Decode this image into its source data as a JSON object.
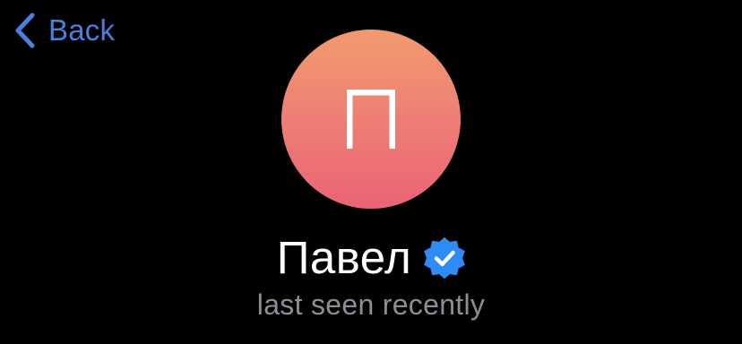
{
  "nav": {
    "back_label": "Back",
    "back_icon": "chevron-left-icon"
  },
  "profile": {
    "avatar_initial": "П",
    "name": "Павел",
    "verified_icon": "verified-badge-icon",
    "status": "last seen recently"
  },
  "colors": {
    "background": "#000000",
    "accent": "#4a7fe0",
    "avatar_gradient_top": "#f29a70",
    "avatar_gradient_bottom": "#ea6476",
    "verified_badge": "#2f8cf7",
    "status_text": "#8d8d93",
    "name_text": "#ffffff"
  }
}
